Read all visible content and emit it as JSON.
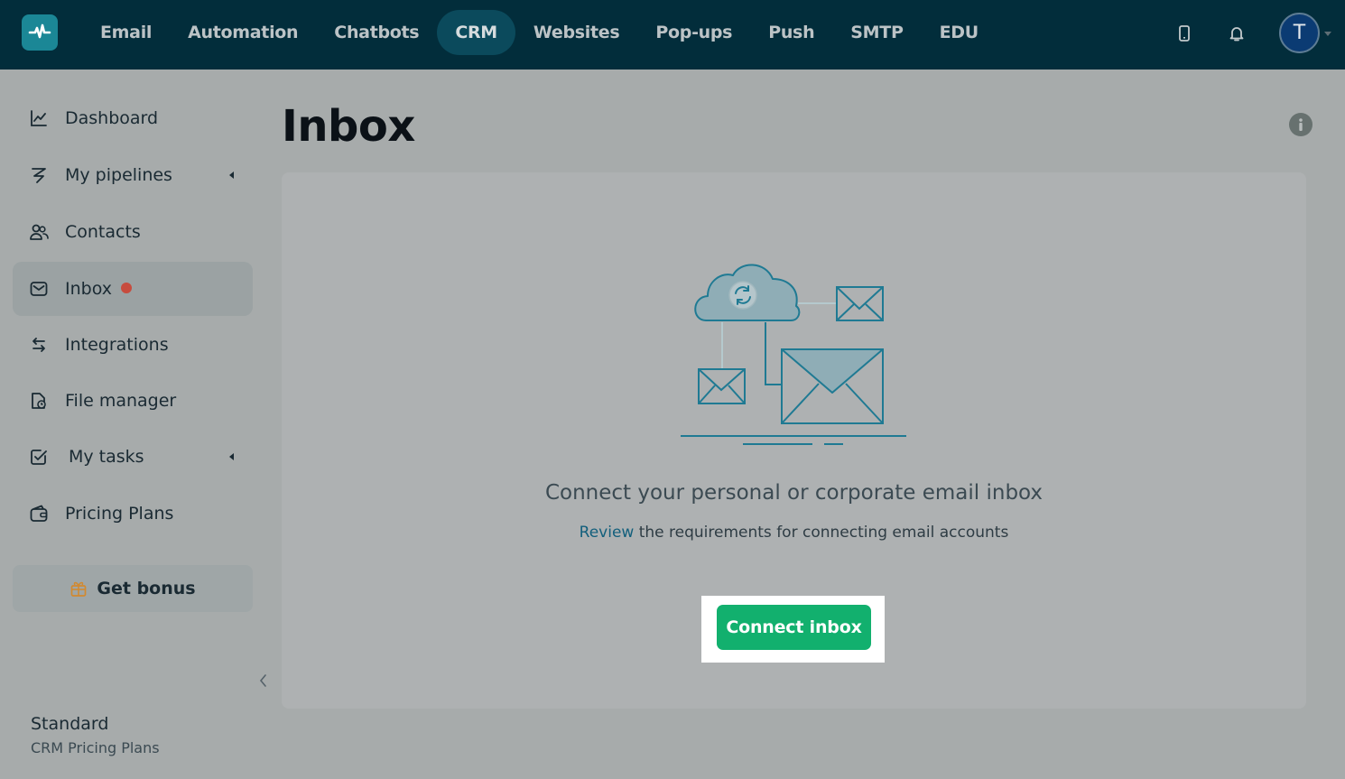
{
  "topbar": {
    "logo_icon": "pulse-logo-icon",
    "nav": [
      {
        "label": "Email"
      },
      {
        "label": "Automation"
      },
      {
        "label": "Chatbots"
      },
      {
        "label": "CRM",
        "active": true
      },
      {
        "label": "Websites"
      },
      {
        "label": "Pop-ups"
      },
      {
        "label": "Push"
      },
      {
        "label": "SMTP"
      },
      {
        "label": "EDU"
      }
    ],
    "icons": [
      "mobile-icon",
      "bell-icon"
    ],
    "avatar_letter": "T",
    "colors": {
      "background": "#022d3b",
      "active_tab": "#0b4a5c",
      "avatar": "#0b3b73"
    }
  },
  "sidebar": {
    "items": [
      {
        "label": "Dashboard",
        "icon": "chart-line-icon"
      },
      {
        "label": "My pipelines",
        "icon": "pipeline-icon",
        "expandable": true
      },
      {
        "label": "Contacts",
        "icon": "contacts-icon"
      },
      {
        "label": "Inbox",
        "icon": "inbox-icon",
        "active": true,
        "notification": true
      },
      {
        "label": "Integrations",
        "icon": "arrows-swap-icon"
      },
      {
        "label": "File manager",
        "icon": "file-manager-icon"
      },
      {
        "label": "My tasks",
        "icon": "task-check-icon",
        "expandable": true
      },
      {
        "label": "Pricing Plans",
        "icon": "wallet-icon"
      }
    ],
    "bonus_label": "Get bonus",
    "bonus_icon": "gift-icon",
    "plan_name": "Standard",
    "plan_link": "CRM Pricing Plans",
    "notification_color": "#c74c3e"
  },
  "main": {
    "title": "Inbox",
    "empty_state": {
      "headline": "Connect your personal or corporate email inbox",
      "link_text": "Review",
      "subline_rest": " the requirements for connecting email accounts",
      "button_label": "Connect inbox",
      "button_color": "#12b06e"
    }
  }
}
